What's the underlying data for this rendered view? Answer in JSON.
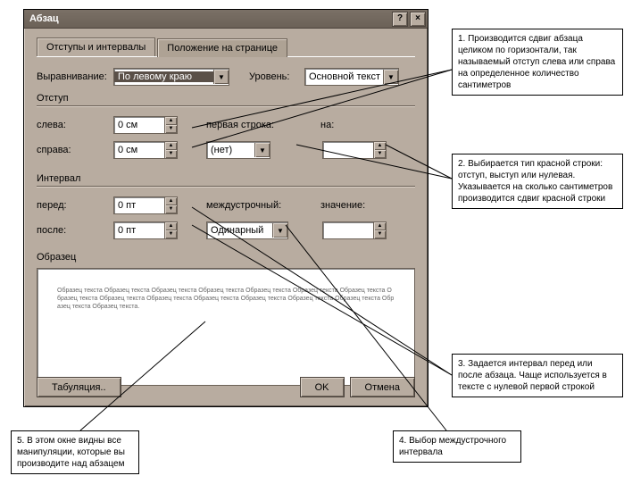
{
  "titlebar": {
    "title": "Абзац",
    "help": "?",
    "close": "×"
  },
  "tabs": {
    "active": "Отступы и интервалы",
    "inactive": "Положение на странице"
  },
  "align": {
    "label": "Выравнивание:",
    "value": "По левому краю",
    "level_label": "Уровень:",
    "level_value": "Основной текст"
  },
  "indent": {
    "group": "Отступ",
    "left_label": "слева:",
    "left_value": "0 см",
    "right_label": "справа:",
    "right_value": "0 см",
    "first_label": "первая строка:",
    "first_value": "(нет)",
    "by_label": "на:",
    "by_value": ""
  },
  "spacing": {
    "group": "Интервал",
    "before_label": "перед:",
    "before_value": "0 пт",
    "after_label": "после:",
    "after_value": "0 пт",
    "line_label": "междустрочный:",
    "line_value": "Одинарный",
    "at_label": "значение:",
    "at_value": ""
  },
  "preview": {
    "label": "Образец",
    "text": "Образец текста Образец текста Образец текста Образец текста Образец текста Образец текста Образец текста Образец текста Образец текста Образец текста Образец текста Образец текста Образец текста Образец текста Образец текста Образец текста."
  },
  "buttons": {
    "tab": "Табуляция..",
    "ok": "OK",
    "cancel": "Отмена"
  },
  "notes": {
    "n1": "1. Производится сдвиг абзаца целиком по горизонтали, так называемый отступ слева или справа на определенное количество сантиметров",
    "n2": "2. Выбирается тип красной строки: отступ, выступ или нулевая. Указывается на сколько сантиметров производится сдвиг красной строки",
    "n3": "3. Задается интервал перед или после абзаца. Чаще используется в тексте с нулевой первой строкой",
    "n4": "4. Выбор междустрочного интервала",
    "n5": "5. В этом окне видны все манипуляции, которые вы производите над абзацем"
  }
}
